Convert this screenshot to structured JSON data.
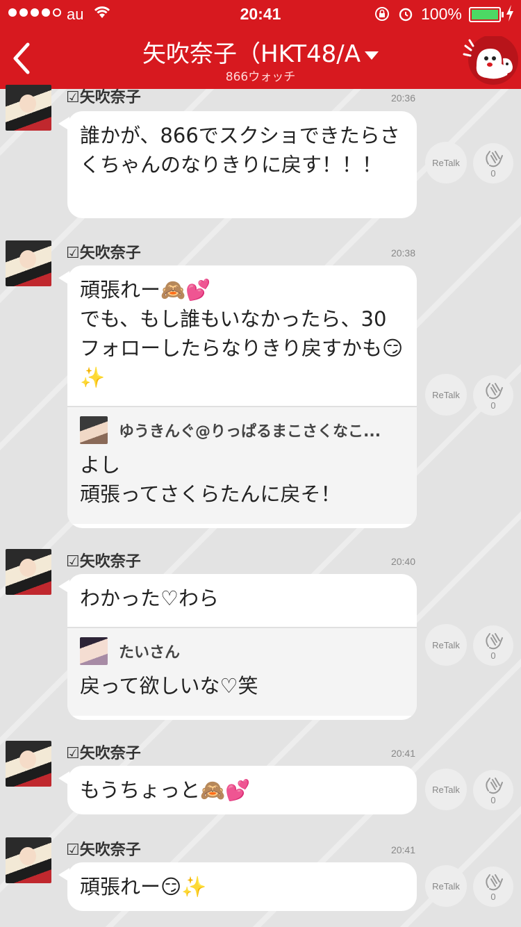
{
  "status_bar": {
    "carrier": "au",
    "time": "20:41",
    "battery_percent": "100%",
    "battery_level": 1.0
  },
  "nav": {
    "title": "矢吹奈子（HKT48/A",
    "subtitle": "866ウォッチ"
  },
  "colors": {
    "brand_red": "#d7191f",
    "bubble_bg": "#ffffff",
    "background": "#e3e3e3"
  },
  "messages": [
    {
      "sender": "☑矢吹奈子",
      "time": "20:36",
      "text": "誰かが、866でスクショできたらさくちゃんのなりきりに戻す！！！",
      "retalk_label": "ReTalk",
      "clap_count": "0"
    },
    {
      "sender": "☑矢吹奈子",
      "time": "20:38",
      "text": "頑張れー🙈💕\nでも、もし誰もいなかったら、30フォローしたらなりきり戻すかも😏✨",
      "quote": {
        "name": "ゆうきんぐ@りっぱるまこさくなこ...",
        "text": "よし\n頑張ってさくらたんに戻そ！"
      },
      "retalk_label": "ReTalk",
      "clap_count": "0"
    },
    {
      "sender": "☑矢吹奈子",
      "time": "20:40",
      "text": "わかった♡わら",
      "quote": {
        "name": "たいさん",
        "text": "戻って欲しいな♡笑"
      },
      "retalk_label": "ReTalk",
      "clap_count": "0"
    },
    {
      "sender": "☑矢吹奈子",
      "time": "20:41",
      "text": "もうちょっと🙈💕",
      "retalk_label": "ReTalk",
      "clap_count": "0"
    },
    {
      "sender": "☑矢吹奈子",
      "time": "20:41",
      "text": "頑張れー😏✨",
      "retalk_label": "ReTalk",
      "clap_count": "0"
    }
  ]
}
